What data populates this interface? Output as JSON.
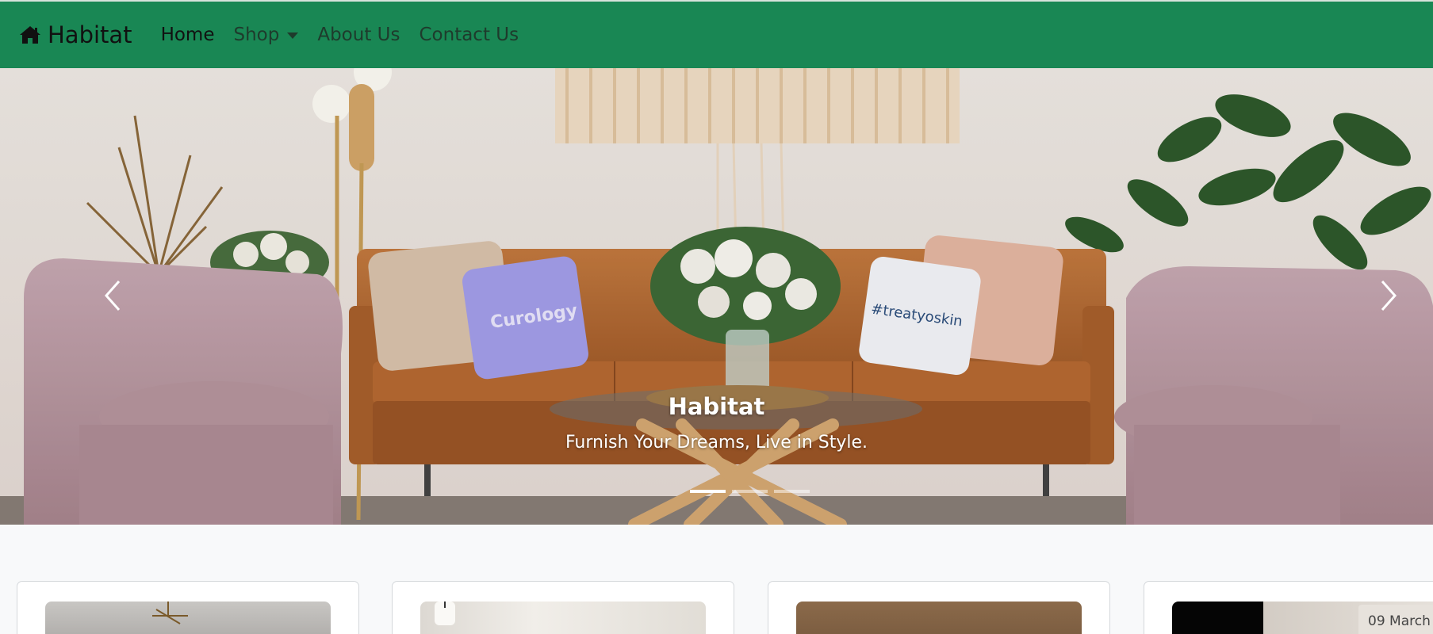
{
  "navbar": {
    "brand": "Habitat",
    "brand_icon": "home-icon",
    "items": [
      {
        "label": "Home",
        "active": true
      },
      {
        "label": "Shop",
        "dropdown": true
      },
      {
        "label": "About Us"
      },
      {
        "label": "Contact Us"
      }
    ],
    "color": "#198754"
  },
  "carousel": {
    "caption_title": "Habitat",
    "caption_text": "Furnish Your Dreams, Live in Style.",
    "slide_count": 3,
    "active_slide": 0,
    "pillow_left_text": "Curology",
    "pillow_right_text": "#treatyoskin"
  },
  "cards": {
    "count_visible": 4,
    "date_badge": "09 March"
  }
}
